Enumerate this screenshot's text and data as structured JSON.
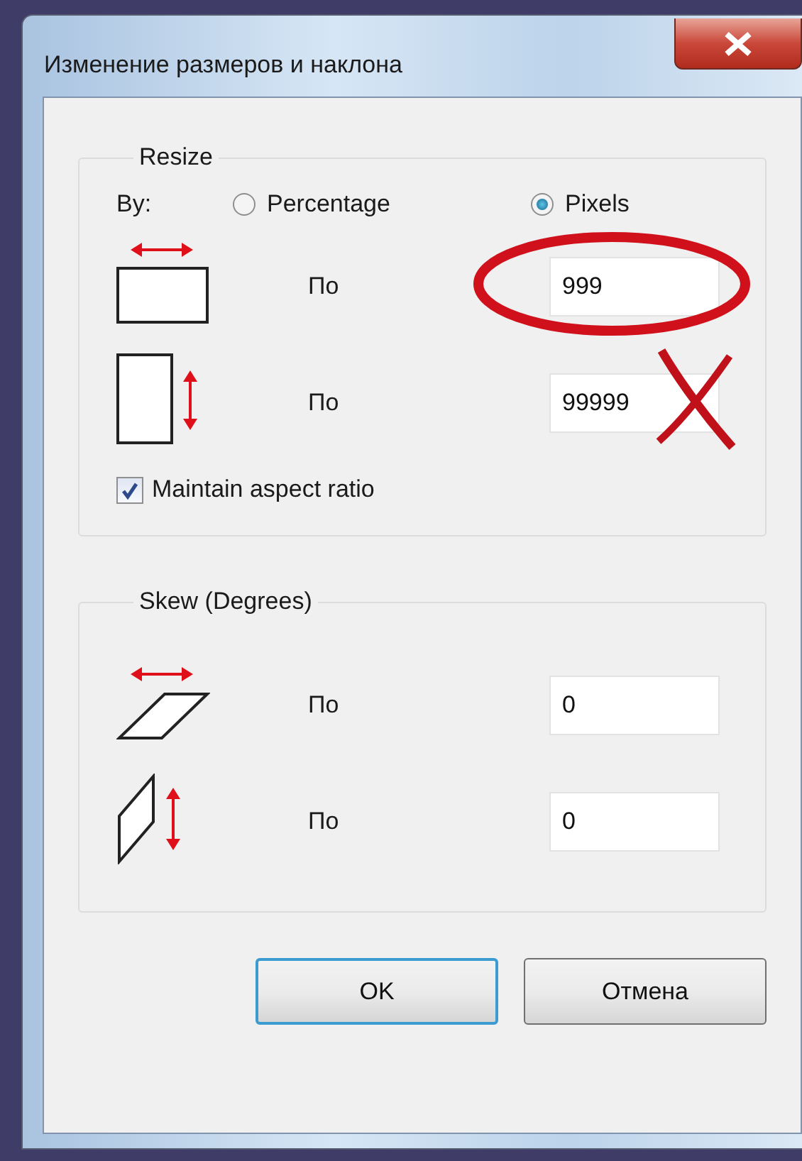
{
  "window": {
    "title": "Изменение размеров и наклона"
  },
  "resize": {
    "legend": "Resize",
    "by_label": "By:",
    "units": [
      {
        "label": "Percentage",
        "selected": false
      },
      {
        "label": "Pixels",
        "selected": true
      }
    ],
    "rows": [
      {
        "kind": "width",
        "label": "По",
        "value": "999",
        "circled": true,
        "crossed": false
      },
      {
        "kind": "height",
        "label": "По",
        "value": "99999",
        "circled": false,
        "crossed": true
      }
    ],
    "aspect": {
      "label": "Maintain aspect ratio",
      "checked": true
    }
  },
  "skew": {
    "legend": "Skew (Degrees)",
    "rows": [
      {
        "kind": "skew_h",
        "label": "По",
        "value": "0"
      },
      {
        "kind": "skew_v",
        "label": "По",
        "value": "0"
      }
    ]
  },
  "buttons": [
    {
      "label": "OK",
      "default": true
    },
    {
      "label": "Отмена",
      "default": false
    }
  ]
}
